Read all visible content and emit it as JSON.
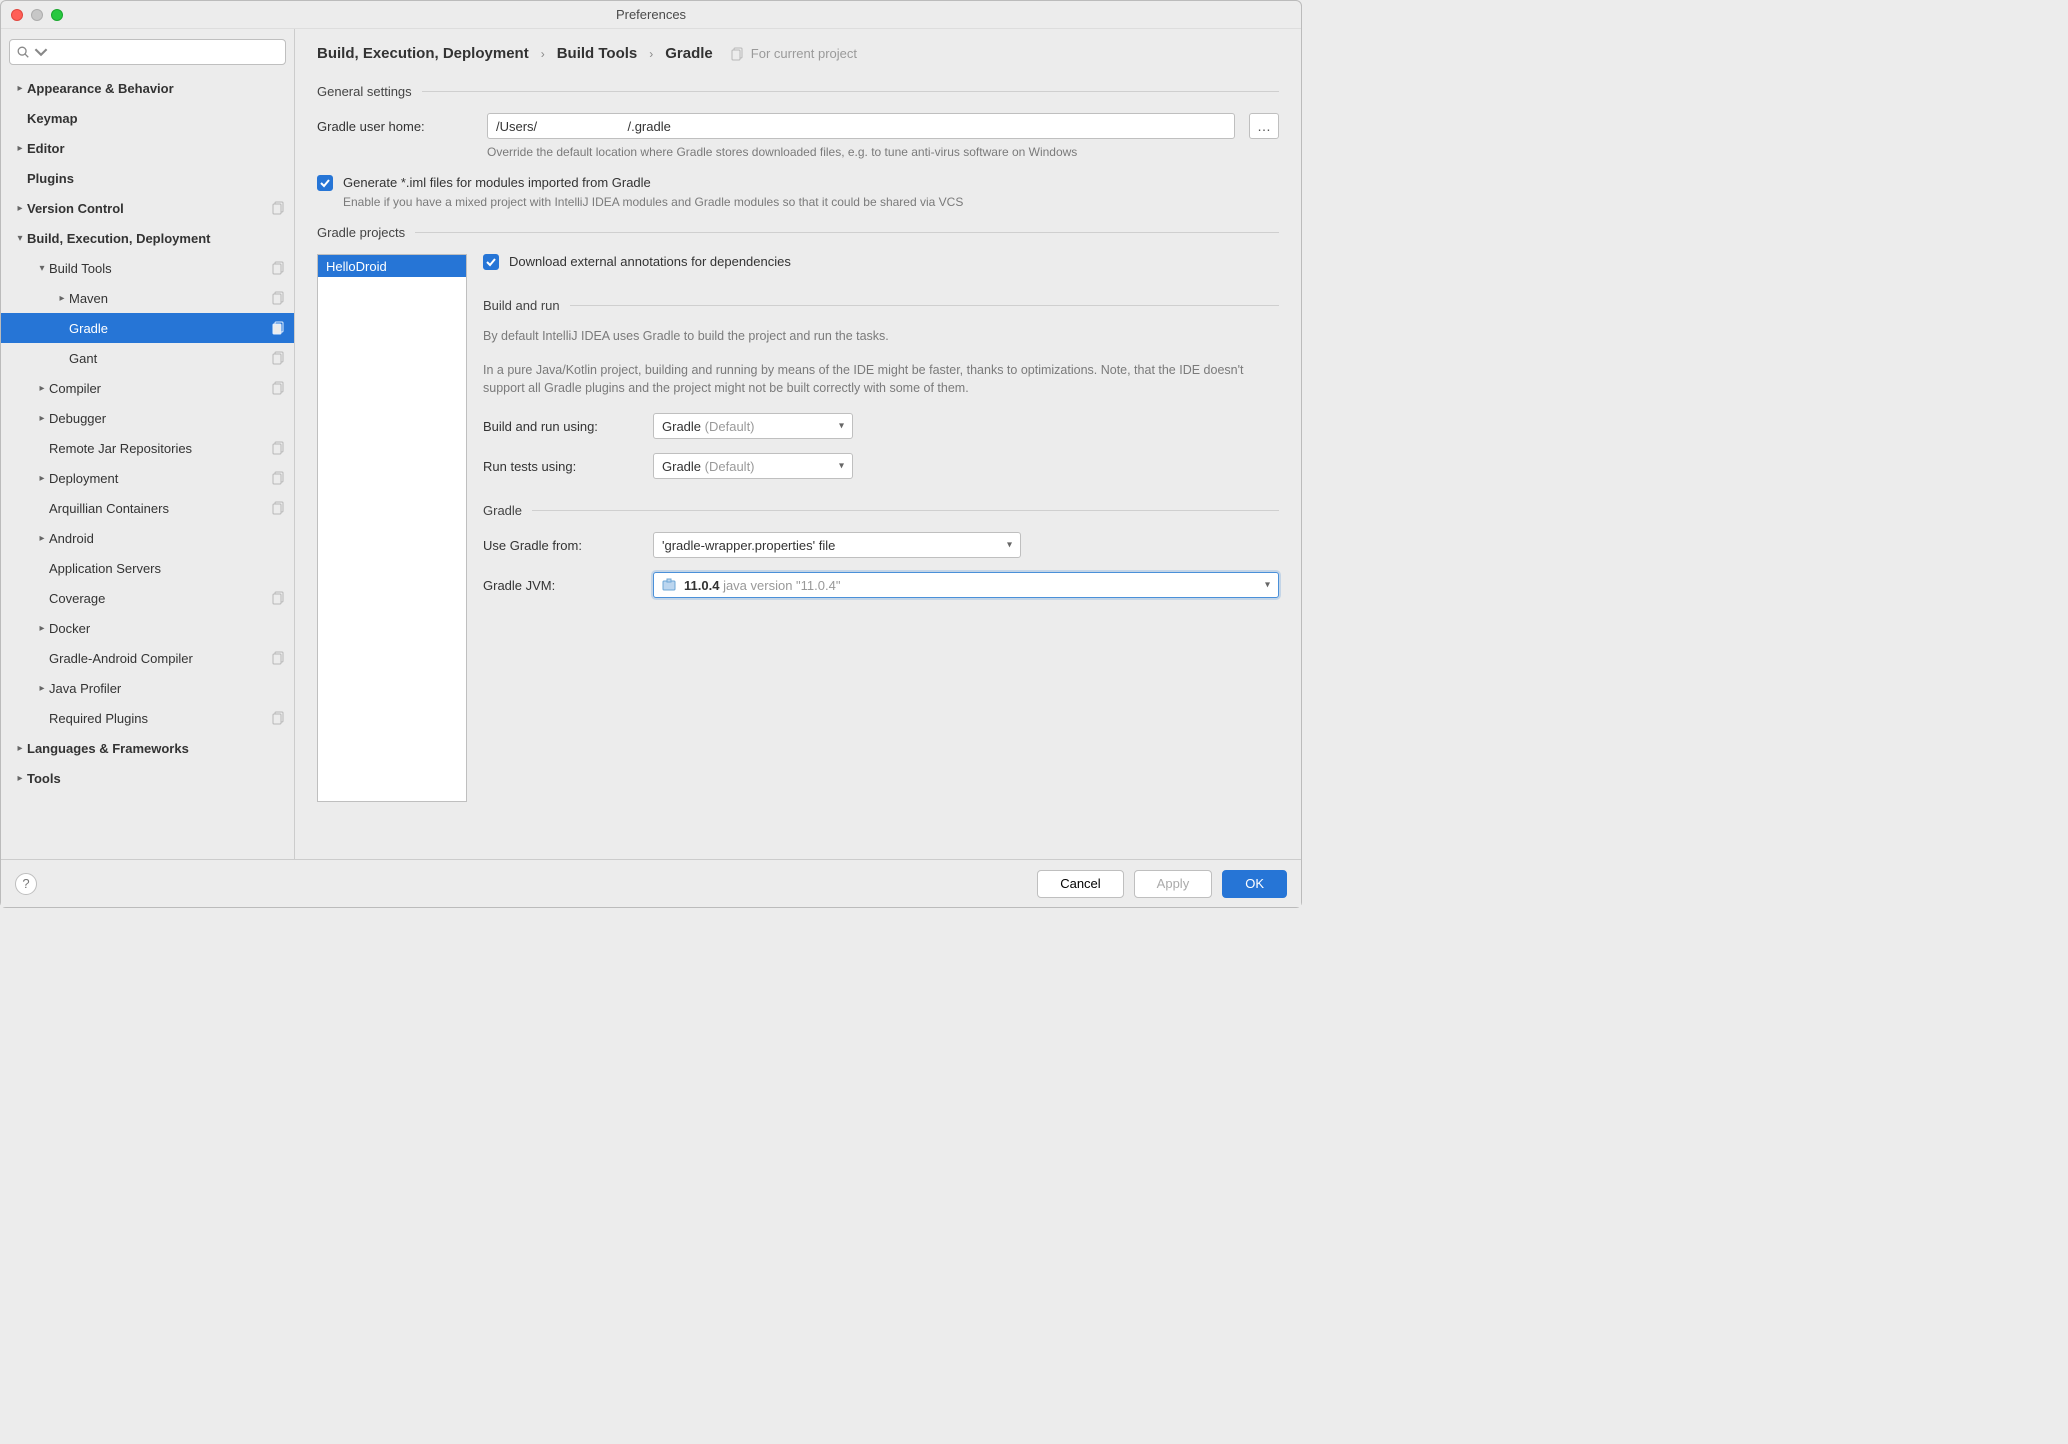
{
  "window": {
    "title": "Preferences"
  },
  "sidebar": {
    "search_placeholder": "",
    "items": [
      {
        "label": "Appearance & Behavior",
        "depth": 0,
        "bold": true,
        "chev": "right",
        "copy": false
      },
      {
        "label": "Keymap",
        "depth": 0,
        "bold": true,
        "chev": "",
        "copy": false
      },
      {
        "label": "Editor",
        "depth": 0,
        "bold": true,
        "chev": "right",
        "copy": false
      },
      {
        "label": "Plugins",
        "depth": 0,
        "bold": true,
        "chev": "",
        "copy": false
      },
      {
        "label": "Version Control",
        "depth": 0,
        "bold": true,
        "chev": "right",
        "copy": true
      },
      {
        "label": "Build, Execution, Deployment",
        "depth": 0,
        "bold": true,
        "chev": "down",
        "copy": false
      },
      {
        "label": "Build Tools",
        "depth": 1,
        "bold": false,
        "chev": "down",
        "copy": true
      },
      {
        "label": "Maven",
        "depth": 2,
        "bold": false,
        "chev": "right",
        "copy": true
      },
      {
        "label": "Gradle",
        "depth": 2,
        "bold": false,
        "chev": "",
        "copy": true,
        "selected": true
      },
      {
        "label": "Gant",
        "depth": 2,
        "bold": false,
        "chev": "",
        "copy": true
      },
      {
        "label": "Compiler",
        "depth": 1,
        "bold": false,
        "chev": "right",
        "copy": true
      },
      {
        "label": "Debugger",
        "depth": 1,
        "bold": false,
        "chev": "right",
        "copy": false
      },
      {
        "label": "Remote Jar Repositories",
        "depth": 1,
        "bold": false,
        "chev": "",
        "copy": true
      },
      {
        "label": "Deployment",
        "depth": 1,
        "bold": false,
        "chev": "right",
        "copy": true
      },
      {
        "label": "Arquillian Containers",
        "depth": 1,
        "bold": false,
        "chev": "",
        "copy": true
      },
      {
        "label": "Android",
        "depth": 1,
        "bold": false,
        "chev": "right",
        "copy": false
      },
      {
        "label": "Application Servers",
        "depth": 1,
        "bold": false,
        "chev": "",
        "copy": false
      },
      {
        "label": "Coverage",
        "depth": 1,
        "bold": false,
        "chev": "",
        "copy": true
      },
      {
        "label": "Docker",
        "depth": 1,
        "bold": false,
        "chev": "right",
        "copy": false
      },
      {
        "label": "Gradle-Android Compiler",
        "depth": 1,
        "bold": false,
        "chev": "",
        "copy": true
      },
      {
        "label": "Java Profiler",
        "depth": 1,
        "bold": false,
        "chev": "right",
        "copy": false
      },
      {
        "label": "Required Plugins",
        "depth": 1,
        "bold": false,
        "chev": "",
        "copy": true
      },
      {
        "label": "Languages & Frameworks",
        "depth": 0,
        "bold": true,
        "chev": "right",
        "copy": false
      },
      {
        "label": "Tools",
        "depth": 0,
        "bold": true,
        "chev": "right",
        "copy": false
      }
    ]
  },
  "header": {
    "breadcrumb": [
      "Build, Execution, Deployment",
      "Build Tools",
      "Gradle"
    ],
    "scope": "For current project"
  },
  "general": {
    "title": "General settings",
    "home_label": "Gradle user home:",
    "home_value": "/Users/                         /.gradle",
    "home_hint": "Override the default location where Gradle stores downloaded files, e.g. to tune anti-virus software on Windows",
    "iml_label": "Generate *.iml files for modules imported from Gradle",
    "iml_hint": "Enable if you have a mixed project with IntelliJ IDEA modules and Gradle modules so that it could be shared via VCS"
  },
  "projects": {
    "title": "Gradle projects",
    "list": [
      "HelloDroid"
    ],
    "download_label": "Download external annotations for dependencies",
    "build_run": {
      "title": "Build and run",
      "note1": "By default IntelliJ IDEA uses Gradle to build the project and run the tasks.",
      "note2": "In a pure Java/Kotlin project, building and running by means of the IDE might be faster, thanks to optimizations. Note, that the IDE doesn't support all Gradle plugins and the project might not be built correctly with some of them.",
      "build_label": "Build and run using:",
      "build_value": "Gradle",
      "build_default": "(Default)",
      "tests_label": "Run tests using:",
      "tests_value": "Gradle",
      "tests_default": "(Default)"
    },
    "gradle": {
      "title": "Gradle",
      "from_label": "Use Gradle from:",
      "from_value": "'gradle-wrapper.properties' file",
      "jvm_label": "Gradle JVM:",
      "jvm_value": "11.0.4",
      "jvm_detail": "java version \"11.0.4\""
    }
  },
  "footer": {
    "cancel": "Cancel",
    "apply": "Apply",
    "ok": "OK"
  }
}
